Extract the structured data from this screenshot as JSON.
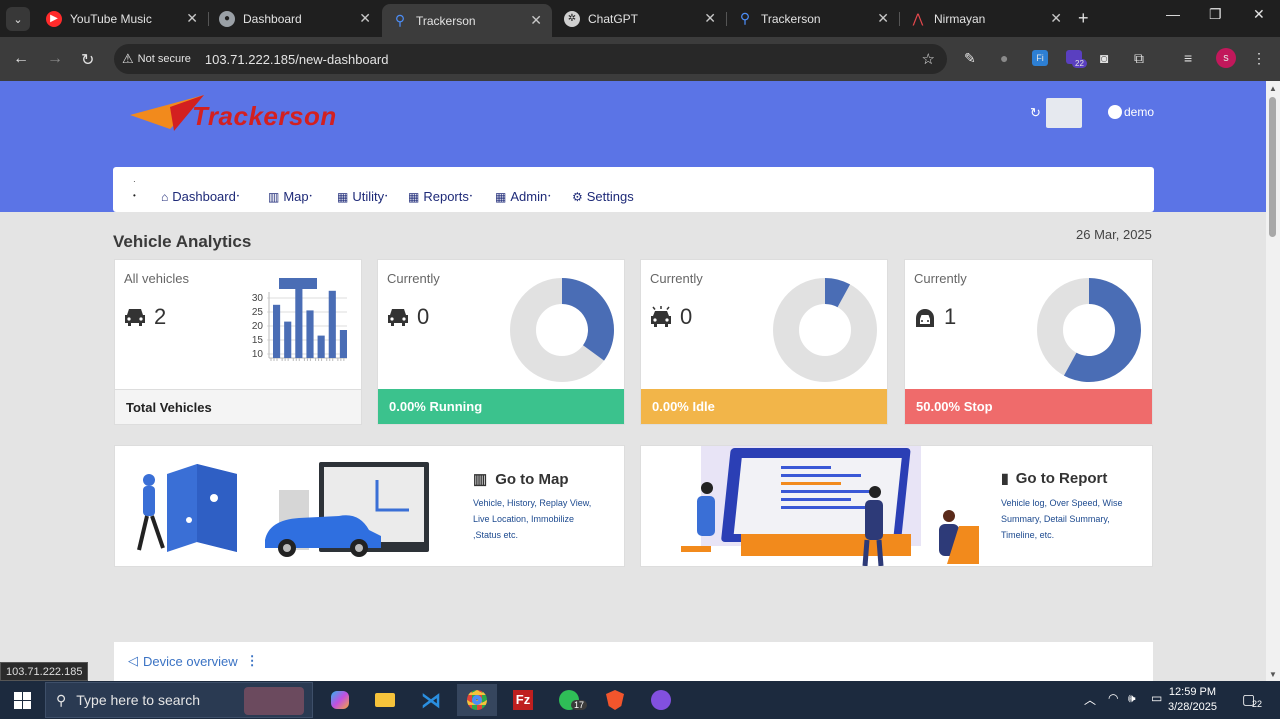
{
  "browser": {
    "tabs": [
      {
        "title": "YouTube Music",
        "icon": "youtube-music-icon",
        "color": "#ff2b2b"
      },
      {
        "title": "Dashboard",
        "icon": "globe-icon",
        "color": "#9aa0a6"
      },
      {
        "title": "Trackerson",
        "icon": "map-pin-icon",
        "color": "#4c8df6"
      },
      {
        "title": "ChatGPT",
        "icon": "chatgpt-icon",
        "color": "#d0d0d0"
      },
      {
        "title": "Trackerson",
        "icon": "map-pin-icon",
        "color": "#4c8df6"
      },
      {
        "title": "Nirmayan",
        "icon": "nirmayan-icon",
        "color": "#e5484d"
      }
    ],
    "active_tab_index": 2,
    "security_label": "Not secure",
    "url": "103.71.222.185/new-dashboard",
    "profile_initial": "s",
    "extension_badge": "22"
  },
  "app": {
    "brand": "Trackerson",
    "user": "demo",
    "nav": [
      {
        "label": "Dashboard",
        "icon": "home-icon"
      },
      {
        "label": "Map",
        "icon": "map-icon"
      },
      {
        "label": "Utility",
        "icon": "grid-icon"
      },
      {
        "label": "Reports",
        "icon": "grid-icon"
      },
      {
        "label": "Admin",
        "icon": "grid-icon"
      },
      {
        "label": "Settings",
        "icon": "gear-icon"
      }
    ],
    "section_title": "Vehicle Analytics",
    "date": "26 Mar, 2025",
    "cards": [
      {
        "caption": "All vehicles",
        "count": "2",
        "footer": "Total Vehicles",
        "icon": "car-icon"
      },
      {
        "caption": "Currently",
        "count": "0",
        "footer": "0.00% Running",
        "icon": "car-icon",
        "fraction": 0.35
      },
      {
        "caption": "Currently",
        "count": "0",
        "footer": "0.00% Idle",
        "icon": "idle-car-icon",
        "fraction": 0.08
      },
      {
        "caption": "Currently",
        "count": "1",
        "footer": "50.00% Stop",
        "icon": "stopped-car-icon",
        "fraction": 0.58
      }
    ],
    "mini_chart": {
      "y_ticks": [
        "30",
        "25",
        "20",
        "15",
        "10"
      ],
      "values": [
        24,
        18,
        30,
        22,
        13,
        29,
        15
      ],
      "ylim": [
        10,
        30
      ]
    },
    "features": [
      {
        "title": "Go to Map",
        "icon": "map-icon",
        "desc_lines": [
          "Vehicle, History, Replay View,",
          "Live Location, Immobilize",
          ",Status etc."
        ]
      },
      {
        "title": "Go to Report",
        "icon": "bar-chart-icon",
        "desc_lines": [
          "Vehicle log, Over Speed, Wise",
          "Summary, Detail Summary,",
          "Timeline, etc."
        ]
      }
    ],
    "device_overview": "Device overview",
    "status_url": "103.71.222.185"
  },
  "taskbar": {
    "search_placeholder": "Type here to search",
    "whatsapp_badge": "17",
    "time": "12:59 PM",
    "date": "3/28/2025",
    "notification_count": "22"
  }
}
